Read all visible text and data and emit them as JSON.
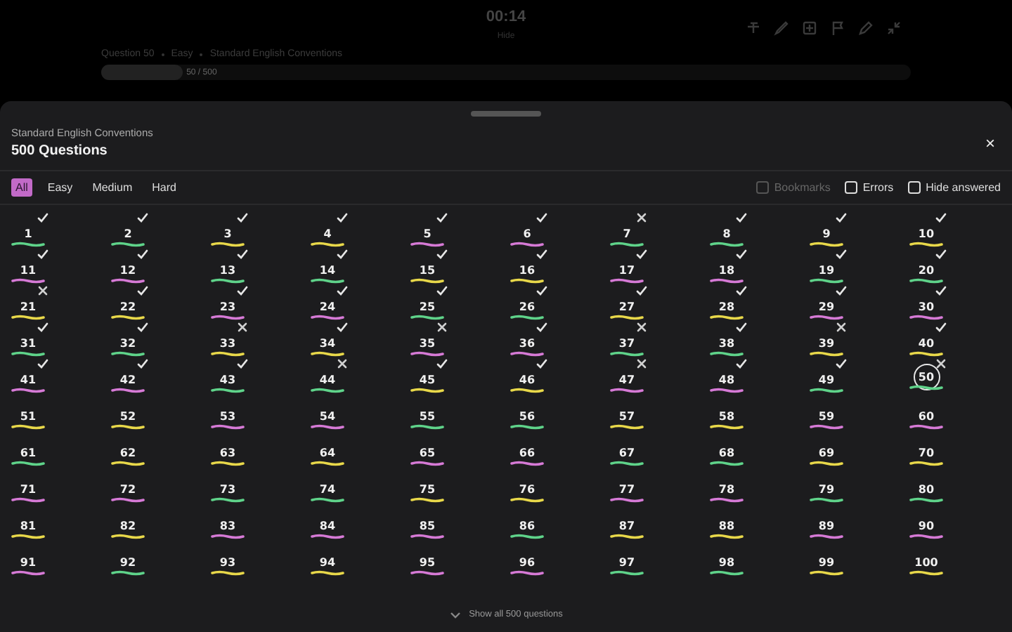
{
  "header": {
    "timer": "00:14",
    "hide_label": "Hide",
    "breadcrumb": [
      "Question 50",
      "Easy",
      "Standard English Conventions"
    ],
    "progress": {
      "level": 0.1,
      "reading": "50 / 500"
    }
  },
  "sheet": {
    "subtitle": "Standard English Conventions",
    "title": "500 Questions",
    "close": "×"
  },
  "filters": [
    {
      "label": "All",
      "selected": true
    },
    {
      "label": "Easy",
      "selected": false
    },
    {
      "label": "Medium",
      "selected": false
    },
    {
      "label": "Hard",
      "selected": false
    }
  ],
  "toggles": [
    {
      "label": "Bookmarks",
      "checked": false,
      "disabled": true
    },
    {
      "label": "Errors",
      "checked": false,
      "disabled": false
    },
    {
      "label": "Hide answered",
      "checked": false,
      "disabled": false
    }
  ],
  "questions": [
    {
      "number": "1",
      "color": "#5fd38a",
      "answered": true,
      "correct": true,
      "selected": false
    },
    {
      "number": "2",
      "color": "#5fd38a",
      "answered": true,
      "correct": true,
      "selected": false
    },
    {
      "number": "3",
      "color": "#e8d84a",
      "answered": true,
      "correct": true,
      "selected": false
    },
    {
      "number": "4",
      "color": "#e8d84a",
      "answered": true,
      "correct": true,
      "selected": false
    },
    {
      "number": "5",
      "color": "#d67ad6",
      "answered": true,
      "correct": true,
      "selected": false
    },
    {
      "number": "6",
      "color": "#d67ad6",
      "answered": true,
      "correct": true,
      "selected": false
    },
    {
      "number": "7",
      "color": "#5fd38a",
      "answered": true,
      "correct": false,
      "selected": false
    },
    {
      "number": "8",
      "color": "#5fd38a",
      "answered": true,
      "correct": true,
      "selected": false
    },
    {
      "number": "9",
      "color": "#e8d84a",
      "answered": true,
      "correct": true,
      "selected": false
    },
    {
      "number": "10",
      "color": "#e8d84a",
      "answered": true,
      "correct": true,
      "selected": false
    },
    {
      "number": "11",
      "color": "#d67ad6",
      "answered": true,
      "correct": true,
      "selected": false
    },
    {
      "number": "12",
      "color": "#d67ad6",
      "answered": true,
      "correct": true,
      "selected": false
    },
    {
      "number": "13",
      "color": "#5fd38a",
      "answered": true,
      "correct": true,
      "selected": false
    },
    {
      "number": "14",
      "color": "#5fd38a",
      "answered": true,
      "correct": true,
      "selected": false
    },
    {
      "number": "15",
      "color": "#e8d84a",
      "answered": true,
      "correct": true,
      "selected": false
    },
    {
      "number": "16",
      "color": "#e8d84a",
      "answered": true,
      "correct": true,
      "selected": false
    },
    {
      "number": "17",
      "color": "#d67ad6",
      "answered": true,
      "correct": true,
      "selected": false
    },
    {
      "number": "18",
      "color": "#d67ad6",
      "answered": true,
      "correct": true,
      "selected": false
    },
    {
      "number": "19",
      "color": "#5fd38a",
      "answered": true,
      "correct": true,
      "selected": false
    },
    {
      "number": "20",
      "color": "#5fd38a",
      "answered": true,
      "correct": true,
      "selected": false
    },
    {
      "number": "21",
      "color": "#e8d84a",
      "answered": true,
      "correct": false,
      "selected": false
    },
    {
      "number": "22",
      "color": "#e8d84a",
      "answered": true,
      "correct": true,
      "selected": false
    },
    {
      "number": "23",
      "color": "#d67ad6",
      "answered": true,
      "correct": true,
      "selected": false
    },
    {
      "number": "24",
      "color": "#d67ad6",
      "answered": true,
      "correct": true,
      "selected": false
    },
    {
      "number": "25",
      "color": "#5fd38a",
      "answered": true,
      "correct": true,
      "selected": false
    },
    {
      "number": "26",
      "color": "#5fd38a",
      "answered": true,
      "correct": true,
      "selected": false
    },
    {
      "number": "27",
      "color": "#e8d84a",
      "answered": true,
      "correct": true,
      "selected": false
    },
    {
      "number": "28",
      "color": "#e8d84a",
      "answered": true,
      "correct": true,
      "selected": false
    },
    {
      "number": "29",
      "color": "#d67ad6",
      "answered": true,
      "correct": true,
      "selected": false
    },
    {
      "number": "30",
      "color": "#d67ad6",
      "answered": true,
      "correct": true,
      "selected": false
    },
    {
      "number": "31",
      "color": "#5fd38a",
      "answered": true,
      "correct": true,
      "selected": false
    },
    {
      "number": "32",
      "color": "#5fd38a",
      "answered": true,
      "correct": true,
      "selected": false
    },
    {
      "number": "33",
      "color": "#e8d84a",
      "answered": true,
      "correct": false,
      "selected": false
    },
    {
      "number": "34",
      "color": "#e8d84a",
      "answered": true,
      "correct": true,
      "selected": false
    },
    {
      "number": "35",
      "color": "#d67ad6",
      "answered": true,
      "correct": false,
      "selected": false
    },
    {
      "number": "36",
      "color": "#d67ad6",
      "answered": true,
      "correct": true,
      "selected": false
    },
    {
      "number": "37",
      "color": "#5fd38a",
      "answered": true,
      "correct": false,
      "selected": false
    },
    {
      "number": "38",
      "color": "#5fd38a",
      "answered": true,
      "correct": true,
      "selected": false
    },
    {
      "number": "39",
      "color": "#e8d84a",
      "answered": true,
      "correct": false,
      "selected": false
    },
    {
      "number": "40",
      "color": "#e8d84a",
      "answered": true,
      "correct": true,
      "selected": false
    },
    {
      "number": "41",
      "color": "#d67ad6",
      "answered": true,
      "correct": true,
      "selected": false
    },
    {
      "number": "42",
      "color": "#d67ad6",
      "answered": true,
      "correct": true,
      "selected": false
    },
    {
      "number": "43",
      "color": "#5fd38a",
      "answered": true,
      "correct": true,
      "selected": false
    },
    {
      "number": "44",
      "color": "#5fd38a",
      "answered": true,
      "correct": false,
      "selected": false
    },
    {
      "number": "45",
      "color": "#e8d84a",
      "answered": true,
      "correct": true,
      "selected": false
    },
    {
      "number": "46",
      "color": "#e8d84a",
      "answered": true,
      "correct": true,
      "selected": false
    },
    {
      "number": "47",
      "color": "#d67ad6",
      "answered": true,
      "correct": false,
      "selected": false
    },
    {
      "number": "48",
      "color": "#d67ad6",
      "answered": true,
      "correct": true,
      "selected": false
    },
    {
      "number": "49",
      "color": "#5fd38a",
      "answered": true,
      "correct": true,
      "selected": false
    },
    {
      "number": "50",
      "color": "#5fd38a",
      "answered": true,
      "correct": false,
      "selected": true
    },
    {
      "number": "51",
      "color": "#e8d84a",
      "answered": false,
      "selected": false
    },
    {
      "number": "52",
      "color": "#e8d84a",
      "answered": false,
      "selected": false
    },
    {
      "number": "53",
      "color": "#d67ad6",
      "answered": false,
      "selected": false
    },
    {
      "number": "54",
      "color": "#d67ad6",
      "answered": false,
      "selected": false
    },
    {
      "number": "55",
      "color": "#5fd38a",
      "answered": false,
      "selected": false
    },
    {
      "number": "56",
      "color": "#5fd38a",
      "answered": false,
      "selected": false
    },
    {
      "number": "57",
      "color": "#e8d84a",
      "answered": false,
      "selected": false
    },
    {
      "number": "58",
      "color": "#e8d84a",
      "answered": false,
      "selected": false
    },
    {
      "number": "59",
      "color": "#d67ad6",
      "answered": false,
      "selected": false
    },
    {
      "number": "60",
      "color": "#d67ad6",
      "answered": false,
      "selected": false
    },
    {
      "number": "61",
      "color": "#5fd38a",
      "answered": false,
      "selected": false
    },
    {
      "number": "62",
      "color": "#e8d84a",
      "answered": false,
      "selected": false
    },
    {
      "number": "63",
      "color": "#e8d84a",
      "answered": false,
      "selected": false
    },
    {
      "number": "64",
      "color": "#e8d84a",
      "answered": false,
      "selected": false
    },
    {
      "number": "65",
      "color": "#d67ad6",
      "answered": false,
      "selected": false
    },
    {
      "number": "66",
      "color": "#d67ad6",
      "answered": false,
      "selected": false
    },
    {
      "number": "67",
      "color": "#5fd38a",
      "answered": false,
      "selected": false
    },
    {
      "number": "68",
      "color": "#5fd38a",
      "answered": false,
      "selected": false
    },
    {
      "number": "69",
      "color": "#e8d84a",
      "answered": false,
      "selected": false
    },
    {
      "number": "70",
      "color": "#e8d84a",
      "answered": false,
      "selected": false
    },
    {
      "number": "71",
      "color": "#d67ad6",
      "answered": false,
      "selected": false
    },
    {
      "number": "72",
      "color": "#d67ad6",
      "answered": false,
      "selected": false
    },
    {
      "number": "73",
      "color": "#5fd38a",
      "answered": false,
      "selected": false
    },
    {
      "number": "74",
      "color": "#5fd38a",
      "answered": false,
      "selected": false
    },
    {
      "number": "75",
      "color": "#e8d84a",
      "answered": false,
      "selected": false
    },
    {
      "number": "76",
      "color": "#e8d84a",
      "answered": false,
      "selected": false
    },
    {
      "number": "77",
      "color": "#d67ad6",
      "answered": false,
      "selected": false
    },
    {
      "number": "78",
      "color": "#d67ad6",
      "answered": false,
      "selected": false
    },
    {
      "number": "79",
      "color": "#5fd38a",
      "answered": false,
      "selected": false
    },
    {
      "number": "80",
      "color": "#5fd38a",
      "answered": false,
      "selected": false
    },
    {
      "number": "81",
      "color": "#e8d84a",
      "answered": false,
      "selected": false
    },
    {
      "number": "82",
      "color": "#e8d84a",
      "answered": false,
      "selected": false
    },
    {
      "number": "83",
      "color": "#d67ad6",
      "answered": false,
      "selected": false
    },
    {
      "number": "84",
      "color": "#d67ad6",
      "answered": false,
      "selected": false
    },
    {
      "number": "85",
      "color": "#d67ad6",
      "answered": false,
      "selected": false
    },
    {
      "number": "86",
      "color": "#5fd38a",
      "answered": false,
      "selected": false
    },
    {
      "number": "87",
      "color": "#e8d84a",
      "answered": false,
      "selected": false
    },
    {
      "number": "88",
      "color": "#e8d84a",
      "answered": false,
      "selected": false
    },
    {
      "number": "89",
      "color": "#d67ad6",
      "answered": false,
      "selected": false
    },
    {
      "number": "90",
      "color": "#d67ad6",
      "answered": false,
      "selected": false
    },
    {
      "number": "91",
      "color": "#d67ad6",
      "answered": false,
      "selected": false
    },
    {
      "number": "92",
      "color": "#5fd38a",
      "answered": false,
      "selected": false
    },
    {
      "number": "93",
      "color": "#e8d84a",
      "answered": false,
      "selected": false
    },
    {
      "number": "94",
      "color": "#e8d84a",
      "answered": false,
      "selected": false
    },
    {
      "number": "95",
      "color": "#d67ad6",
      "answered": false,
      "selected": false
    },
    {
      "number": "96",
      "color": "#d67ad6",
      "answered": false,
      "selected": false
    },
    {
      "number": "97",
      "color": "#5fd38a",
      "answered": false,
      "selected": false
    },
    {
      "number": "98",
      "color": "#5fd38a",
      "answered": false,
      "selected": false
    },
    {
      "number": "99",
      "color": "#e8d84a",
      "answered": false,
      "selected": false
    },
    {
      "number": "100",
      "color": "#e8d84a",
      "answered": false,
      "selected": false
    }
  ],
  "footer": {
    "show_all": "Show all 500 questions"
  }
}
